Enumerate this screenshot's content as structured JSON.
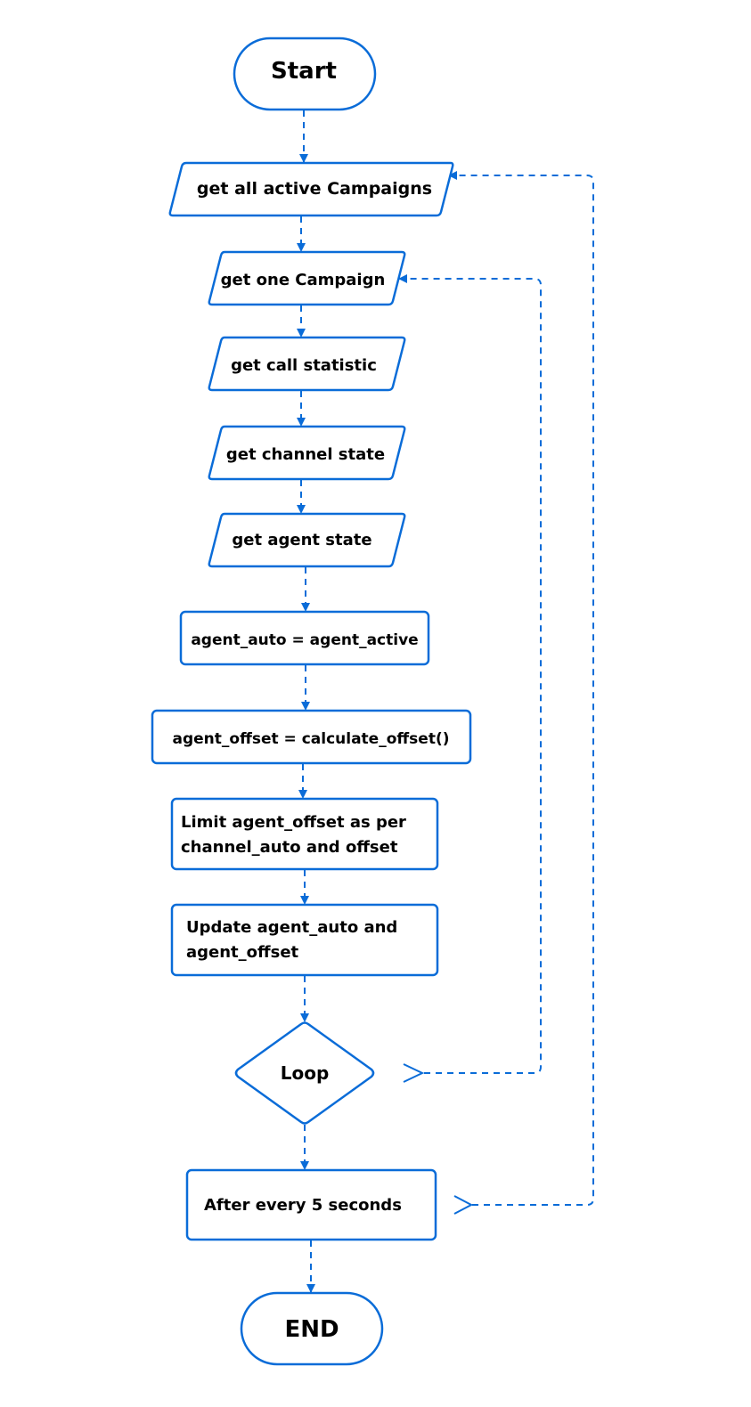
{
  "accent_color": "#0a6cd8",
  "nodes": {
    "start": "Start",
    "get_all_campaigns": "get all active Campaigns",
    "get_one_campaign": "get one Campaign",
    "get_call_statistic": "get call statistic",
    "get_channel_state": "get channel state",
    "get_agent_state": "get agent state",
    "agent_auto": "agent_auto = agent_active",
    "agent_offset": "agent_offset = calculate_offset()",
    "limit_line1": "Limit agent_offset as per",
    "limit_line2": "channel_auto and offset",
    "update_line1": "Update agent_auto and",
    "update_line2": "agent_offset",
    "loop": "Loop",
    "after_every": "After every 5 seconds",
    "end": "END"
  }
}
